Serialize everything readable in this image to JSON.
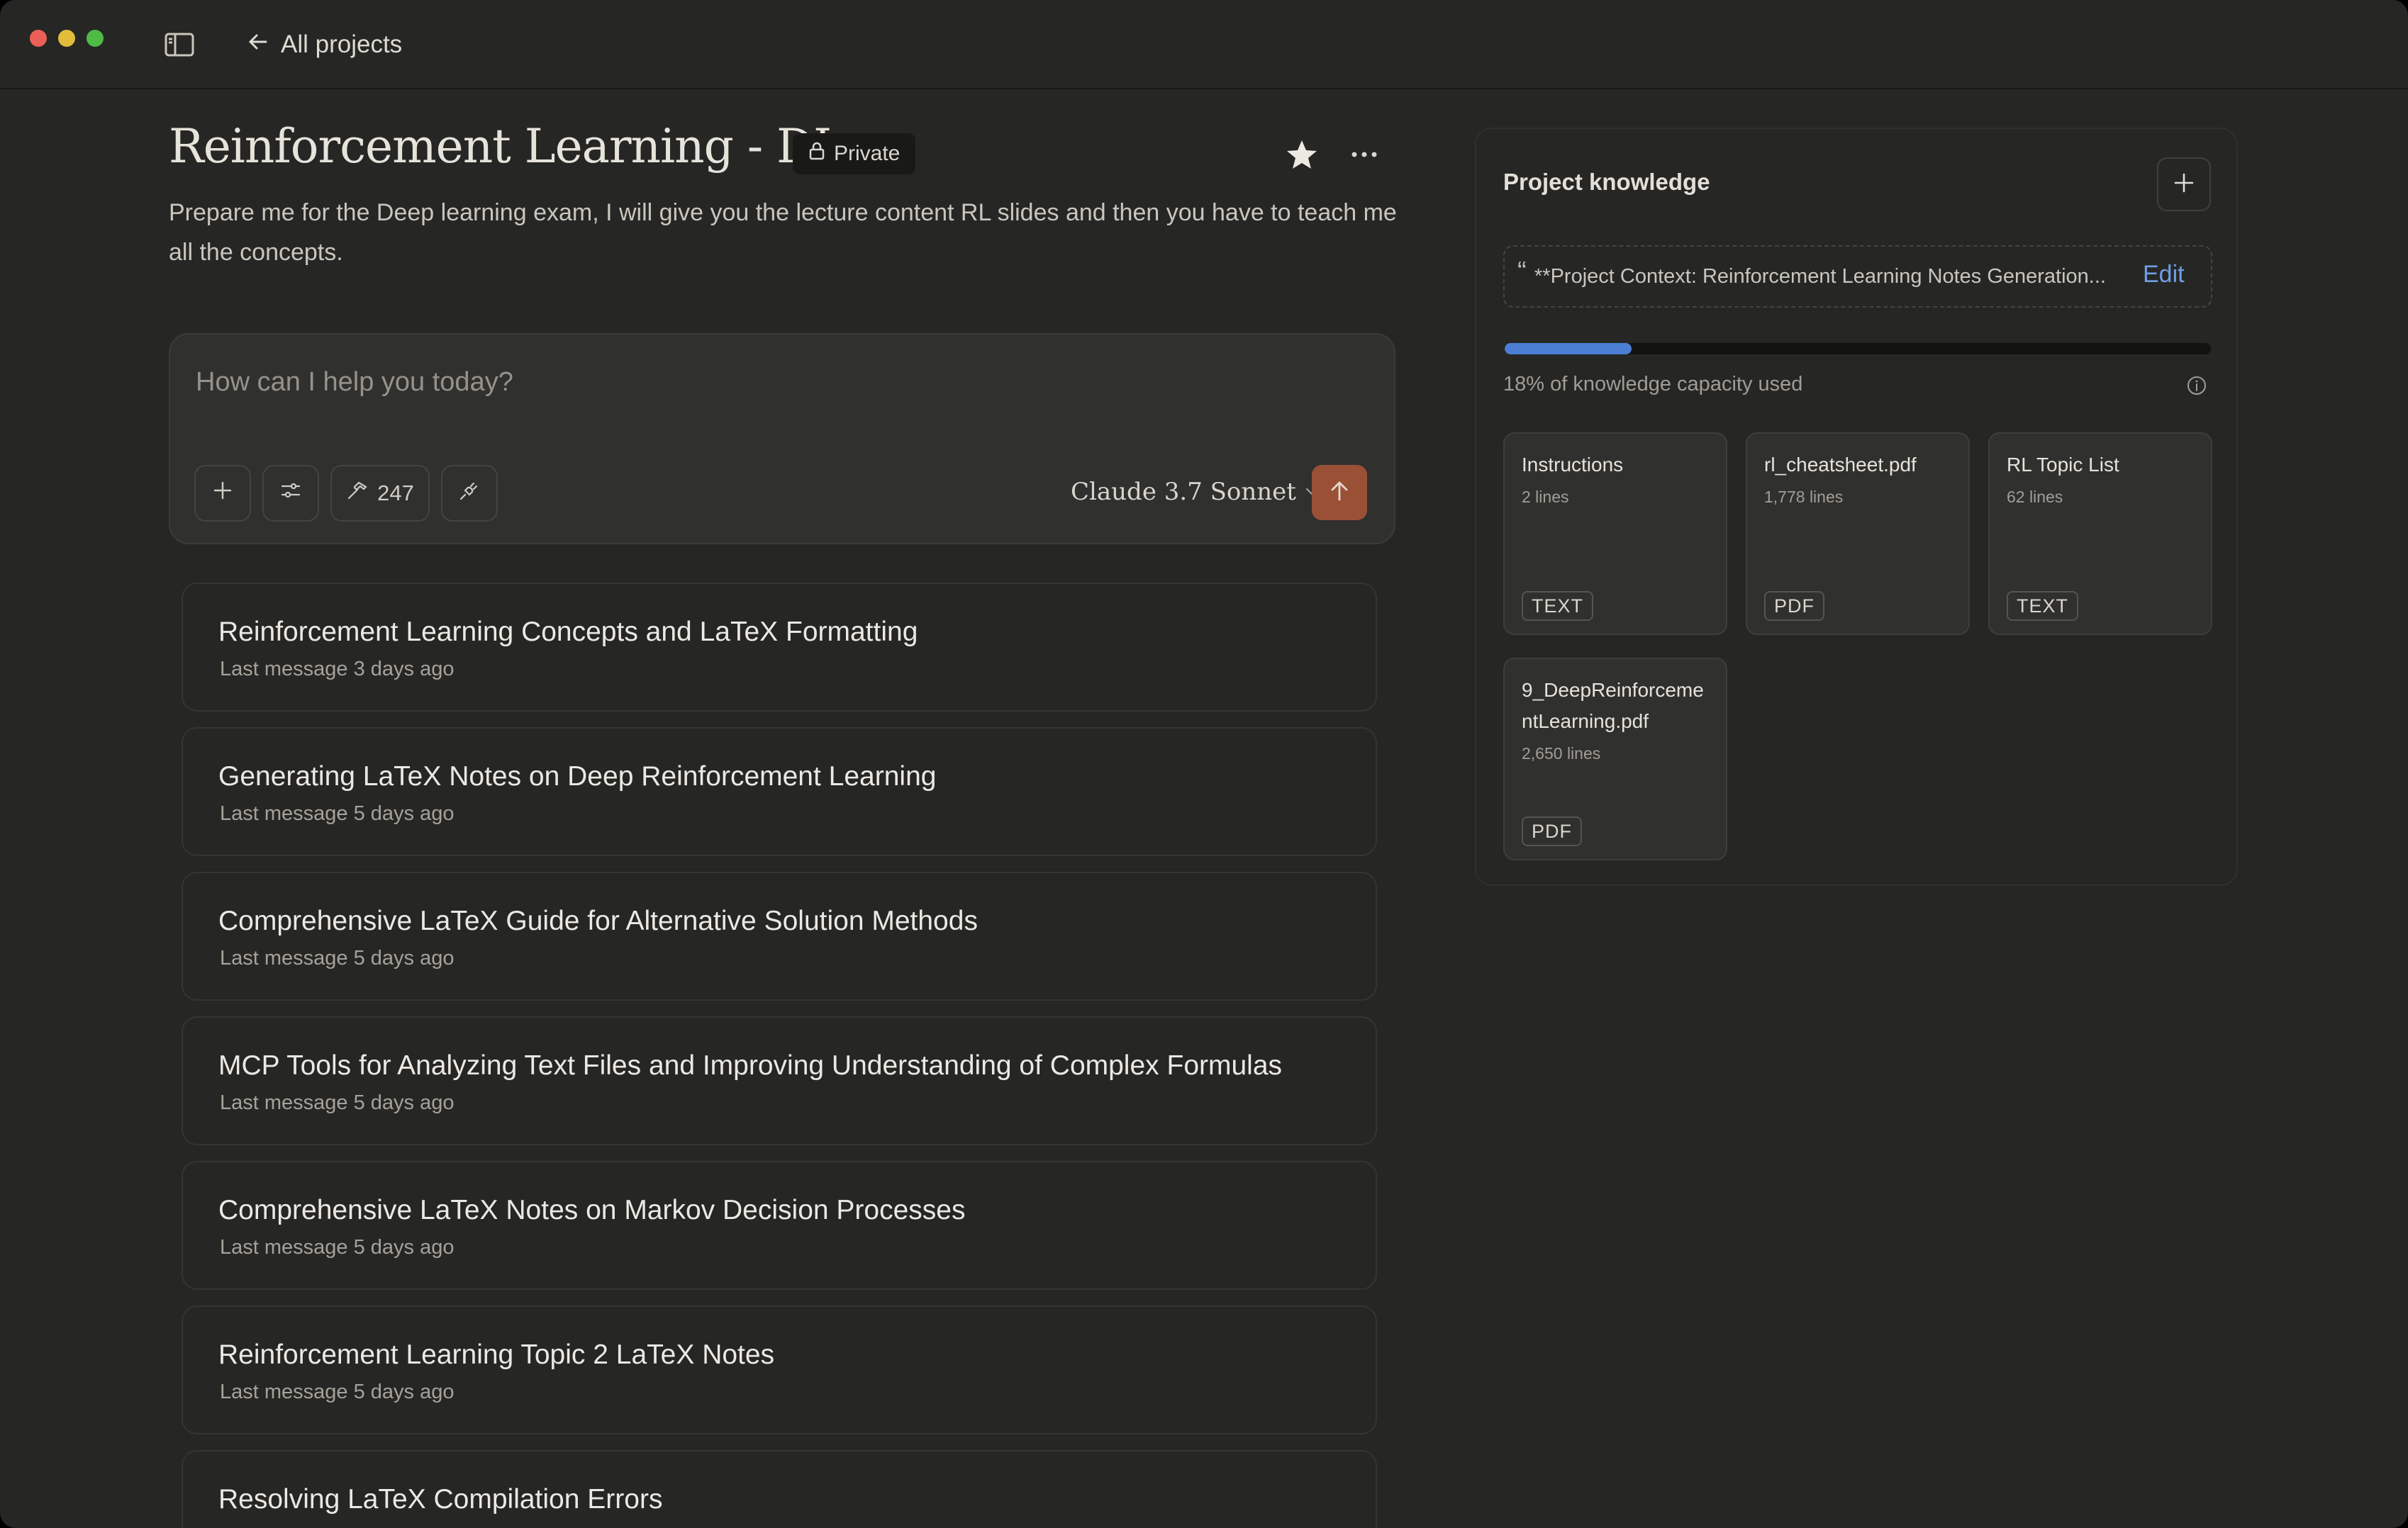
{
  "titlebar": {
    "back_label": "All projects"
  },
  "project": {
    "title": "Reinforcement Learning - DL",
    "visibility": "Private",
    "description": "Prepare me for the Deep learning exam, I will give you the lecture content RL slides and then you have to teach me all the concepts."
  },
  "composer": {
    "placeholder": "How can I help you today?",
    "tools_count": "247",
    "model": "Claude 3.7 Sonnet"
  },
  "chats": [
    {
      "title": "Reinforcement Learning Concepts and LaTeX Formatting",
      "meta": "Last message 3 days ago"
    },
    {
      "title": "Generating LaTeX Notes on Deep Reinforcement Learning",
      "meta": "Last message 5 days ago"
    },
    {
      "title": "Comprehensive LaTeX Guide for Alternative Solution Methods",
      "meta": "Last message 5 days ago"
    },
    {
      "title": "MCP Tools for Analyzing Text Files and Improving Understanding of Complex Formulas",
      "meta": "Last message 5 days ago"
    },
    {
      "title": "Comprehensive LaTeX Notes on Markov Decision Processes",
      "meta": "Last message 5 days ago"
    },
    {
      "title": "Reinforcement Learning Topic 2 LaTeX Notes",
      "meta": "Last message 5 days ago"
    },
    {
      "title": "Resolving LaTeX Compilation Errors",
      "meta": ""
    }
  ],
  "knowledge": {
    "title": "Project knowledge",
    "context_quote": "“",
    "context_text": "**Project Context: Reinforcement Learning Notes Generation...",
    "edit_label": "Edit",
    "capacity_fraction": 0.18,
    "capacity_label": "18% of knowledge capacity used",
    "files": [
      {
        "name": "Instructions",
        "lines": "2 lines",
        "type": "TEXT"
      },
      {
        "name": "rl_cheatsheet.pdf",
        "lines": "1,778 lines",
        "type": "PDF"
      },
      {
        "name": "RL Topic List",
        "lines": "62 lines",
        "type": "TEXT"
      },
      {
        "name": "9_DeepReinforcementLearning.pdf",
        "lines": "2,650 lines",
        "type": "PDF"
      }
    ]
  },
  "colors": {
    "background": "#262624",
    "accent_send": "#9a5035",
    "link": "#6f9ee6",
    "capacity_fill": "#4a7fd3"
  },
  "icons": [
    "sidebar-icon",
    "arrow-left-icon",
    "lock-icon",
    "star-icon",
    "more-icon",
    "plus-icon",
    "sliders-icon",
    "hammer-icon",
    "plug-icon",
    "chevron-down-icon",
    "arrow-up-icon",
    "info-icon"
  ]
}
